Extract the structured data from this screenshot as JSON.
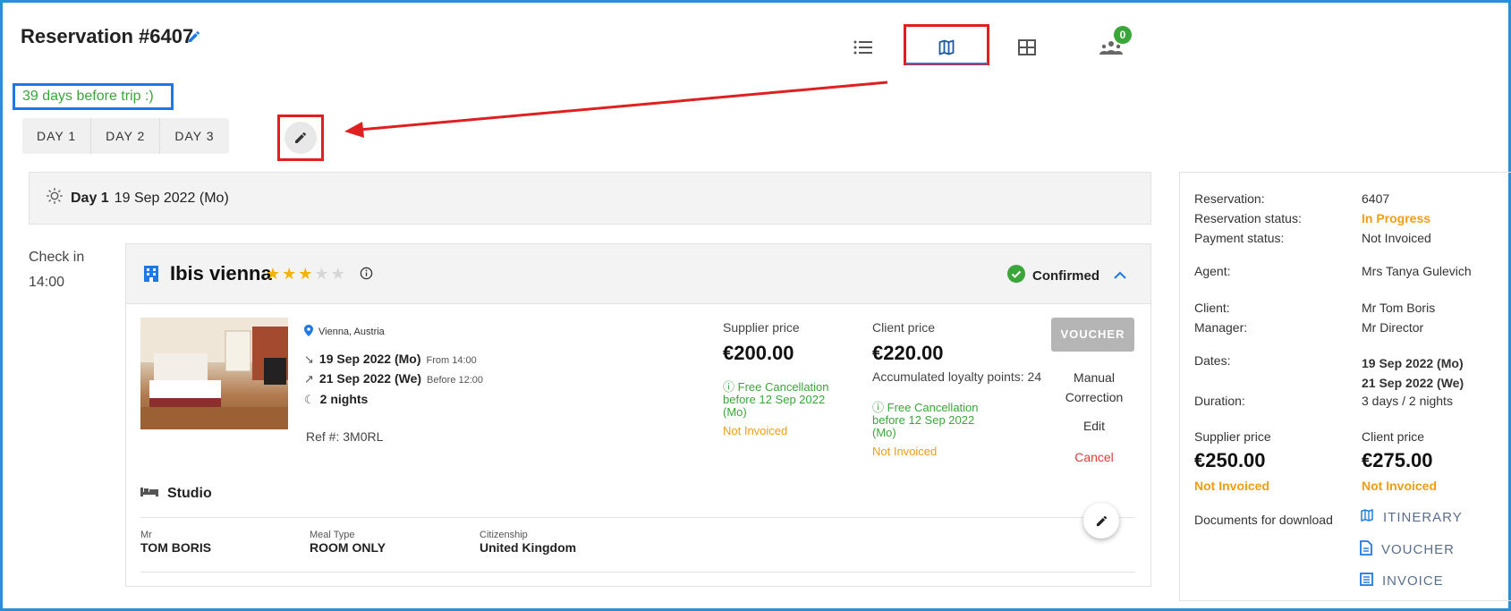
{
  "header": {
    "title": "Reservation #6407",
    "days_before": "39 days before trip :)",
    "badge_count": "0"
  },
  "tabs": [
    {
      "label": "DAY 1"
    },
    {
      "label": "DAY 2"
    },
    {
      "label": "DAY 3"
    }
  ],
  "view_icons": [
    "list-icon",
    "map-icon",
    "table-icon",
    "people-icon"
  ],
  "day": {
    "label": "Day 1",
    "date": "19 Sep 2022 (Mo)",
    "check_in_label": "Check in",
    "check_in_time": "14:00"
  },
  "hotel": {
    "name": "Ibis vienna",
    "stars_filled": 3,
    "stars_total": 5,
    "status": "Confirmed",
    "location": "Vienna, Austria",
    "checkin_date": "19 Sep 2022 (Mo)",
    "checkin_note": "From 14:00",
    "checkout_date": "21 Sep 2022 (We)",
    "checkout_note": "Before 12:00",
    "nights": "2 nights",
    "ref": "Ref #: 3M0RL",
    "supplier_price_label": "Supplier price",
    "supplier_price": "€200.00",
    "supplier_cancel": "Free Cancellation before 12 Sep 2022 (Mo)",
    "supplier_invoice": "Not Invoiced",
    "client_price_label": "Client price",
    "client_price": "€220.00",
    "loyalty": "Accumulated loyalty points: 24",
    "client_cancel": "Free Cancellation before 12 Sep 2022 (Mo)",
    "client_invoice": "Not Invoiced",
    "voucher_btn": "VOUCHER",
    "manual_correction": "Manual Correction",
    "edit": "Edit",
    "cancel": "Cancel",
    "room_type": "Studio",
    "guest_title": "Mr",
    "guest_name": "TOM BORIS",
    "meal_label": "Meal Type",
    "meal_value": "ROOM ONLY",
    "citizenship_label": "Citizenship",
    "citizenship_value": "United Kingdom"
  },
  "summary": {
    "reservation_label": "Reservation:",
    "reservation_value": "6407",
    "status_label": "Reservation status:",
    "status_value": "In Progress",
    "payment_label": "Payment status:",
    "payment_value": "Not Invoiced",
    "agent_label": "Agent:",
    "agent_value": "Mrs Tanya Gulevich",
    "client_label": "Client:",
    "client_value": "Mr Tom Boris",
    "manager_label": "Manager:",
    "manager_value": "Mr Director",
    "dates_label": "Dates:",
    "date_from": "19 Sep 2022 (Mo)",
    "date_to": "21 Sep 2022 (We)",
    "duration_label": "Duration:",
    "duration_value": "3 days / 2 nights",
    "supplier_label": "Supplier price",
    "supplier_value": "€250.00",
    "supplier_invoice": "Not Invoiced",
    "client_price_label": "Client price",
    "client_price_value": "€275.00",
    "client_invoice": "Not Invoiced",
    "documents_label": "Documents for download",
    "docs": [
      {
        "label": "ITINERARY"
      },
      {
        "label": "VOUCHER"
      },
      {
        "label": "INVOICE"
      }
    ]
  },
  "colors": {
    "accent": "#1e78e6",
    "highlight_red": "#e02020",
    "success": "#3aa63a",
    "warning": "#f39c12",
    "danger": "#e23b3b"
  }
}
